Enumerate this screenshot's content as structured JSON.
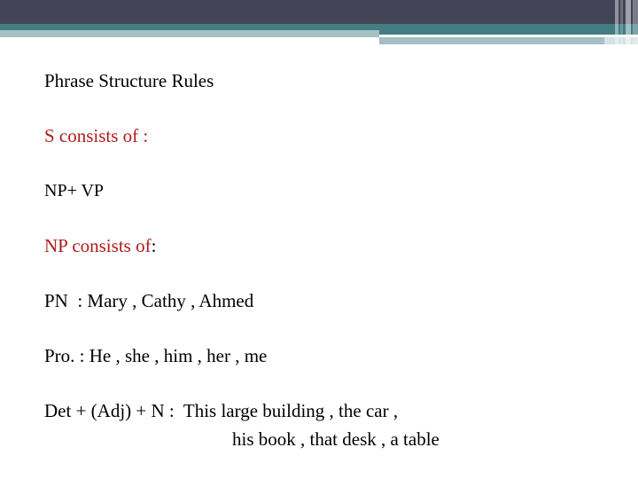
{
  "slide": {
    "title": "Phrase Structure Rules",
    "header": {
      "navy_color": "#434456",
      "teal_color": "#437e84",
      "pale_blue_color": "#a5bfc4",
      "pale_tail_color": "#d5e2e4"
    },
    "text_colors": {
      "body": "#000000",
      "accent_red": "#b01b1b"
    },
    "lines": [
      {
        "id": "title",
        "text": "Phrase Structure Rules",
        "color": "black"
      },
      {
        "id": "s_rule",
        "text": "S consists of :",
        "color": "red"
      },
      {
        "id": "np_vp",
        "text": "NP+ VP",
        "color": "black"
      },
      {
        "id": "np_rule",
        "text": "NP consists of",
        "color": "red",
        "trailing_punct": ":"
      },
      {
        "id": "pn",
        "text": "PN  : Mary , Cathy , Ahmed",
        "color": "black"
      },
      {
        "id": "pro",
        "text": "Pro. : He , she , him , her , me",
        "color": "black"
      },
      {
        "id": "det_1",
        "text": "Det + (Adj) + N :  This large building , the car ,",
        "color": "black"
      },
      {
        "id": "det_2",
        "text": "his book , that desk , a table",
        "color": "black"
      }
    ]
  }
}
